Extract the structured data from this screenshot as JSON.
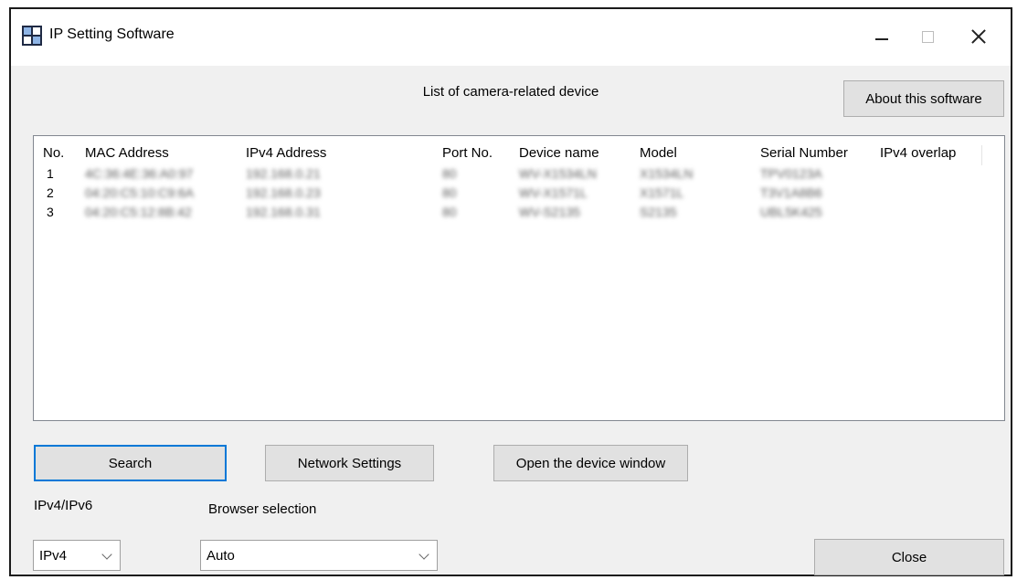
{
  "window": {
    "title": "IP Setting Software",
    "icons": {
      "app": "app-grid-icon",
      "minimize": "minimize-icon",
      "maximize": "maximize-icon",
      "close": "close-icon"
    }
  },
  "list_title": "List of camera-related device",
  "about_label": "About this software",
  "table": {
    "columns": [
      "No.",
      "MAC Address",
      "IPv4 Address",
      "Port No.",
      "Device name",
      "Model",
      "Serial Number",
      "IPv4 overlap"
    ],
    "rows": [
      [
        "1",
        "4C:36:4E:36:A0:97",
        "192.168.0.21",
        "80",
        "WV-X1534LN",
        "X1534LN",
        "TPV0123A",
        ""
      ],
      [
        "2",
        "04:20:C5:10:C9:6A",
        "192.168.0.23",
        "80",
        "WV-X1571L",
        "X1571L",
        "T3V1A8B6",
        ""
      ],
      [
        "3",
        "04:20:C5:12:8B:42",
        "192.168.0.31",
        "80",
        "WV-S2135",
        "S2135",
        "UBL5K425",
        ""
      ]
    ]
  },
  "buttons": {
    "search": "Search",
    "network": "Network Settings",
    "open": "Open the device window",
    "close": "Close"
  },
  "ip_version": {
    "label": "IPv4/IPv6",
    "value": "IPv4"
  },
  "browser": {
    "label": "Browser selection",
    "value": "Auto"
  }
}
